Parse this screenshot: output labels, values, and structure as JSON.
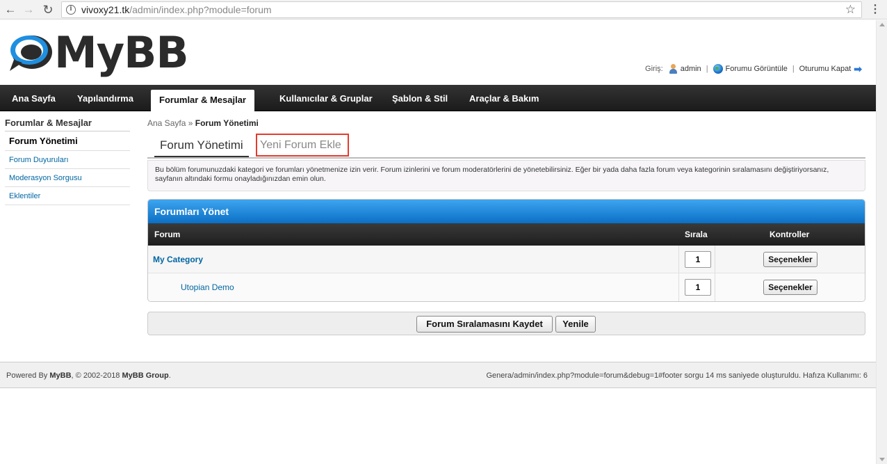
{
  "browser": {
    "url_host": "vivoxy21.tk",
    "url_path": "/admin/index.php?module=forum"
  },
  "header": {
    "logo_text": "MyBB",
    "login_label": "Giriş:",
    "username": "admin",
    "view_forum": "Forumu Görüntüle",
    "logout": "Oturumu Kapat"
  },
  "nav": {
    "tabs": [
      {
        "label": "Ana Sayfa"
      },
      {
        "label": "Yapılandırma"
      },
      {
        "label": "Forumlar & Mesajlar"
      },
      {
        "label": "Kullanıcılar & Gruplar"
      },
      {
        "label": "Şablon & Stil"
      },
      {
        "label": "Araçlar & Bakım"
      }
    ]
  },
  "sidebar": {
    "title": "Forumlar & Mesajlar",
    "items": [
      {
        "label": "Forum Yönetimi"
      },
      {
        "label": "Forum Duyuruları"
      },
      {
        "label": "Moderasyon Sorgusu"
      },
      {
        "label": "Eklentiler"
      }
    ]
  },
  "breadcrumb": {
    "home": "Ana Sayfa",
    "sep": "»",
    "current": "Forum Yönetimi"
  },
  "tabs": {
    "current": "Forum Yönetimi",
    "other": "Yeni Forum Ekle"
  },
  "description": "Bu bölüm forumunuzdaki kategori ve forumları yönetmenize izin verir. Forum izinlerini ve forum moderatörlerini de yönetebilirsiniz. Eğer bir yada daha fazla forum veya kategorinin sıralamasını değiştiriyorsanız, sayfanın altındaki formu onayladığınızdan emin olun.",
  "panel": {
    "title": "Forumları Yönet",
    "columns": {
      "forum": "Forum",
      "order": "Sırala",
      "controls": "Kontroller"
    },
    "rows": [
      {
        "name": "My Category",
        "order": "1",
        "options": "Seçenekler"
      },
      {
        "name": "Utopian Demo",
        "order": "1",
        "options": "Seçenekler"
      }
    ]
  },
  "actions": {
    "save": "Forum Sıralamasını Kaydet",
    "reset": "Yenile"
  },
  "footer": {
    "powered_by": "Powered By",
    "mybb": "MyBB",
    "copyright": ", © 2002-2018",
    "group": "MyBB Group",
    "period": ".",
    "generated": "Genera/admin/index.php?module=forum&debug=1#footer sorgu 14 ms saniyede oluşturuldu. Hafıza Kullanımı: 6"
  },
  "colors": {
    "accent_blue": "#0b6fc4",
    "nav_dark": "#1b1b1b",
    "link": "#0066a2",
    "highlight_red": "#e53a2b"
  }
}
